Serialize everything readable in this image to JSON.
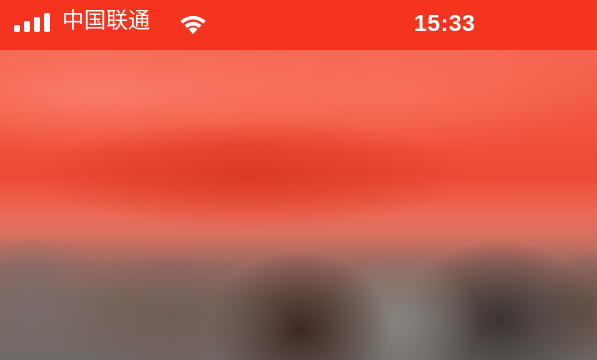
{
  "status_bar": {
    "carrier": "中国联通",
    "time": "15:33",
    "signal_strength": "4 of 4",
    "icons": {
      "signal": "cellular-signal-icon",
      "wifi": "wifi-icon"
    },
    "background_color": "#f4341f",
    "text_color": "#ffffff"
  },
  "content": {
    "description_state": "blurred",
    "dominant_colors": [
      "#f36c58",
      "#ee4a35",
      "#6f6a66"
    ]
  }
}
